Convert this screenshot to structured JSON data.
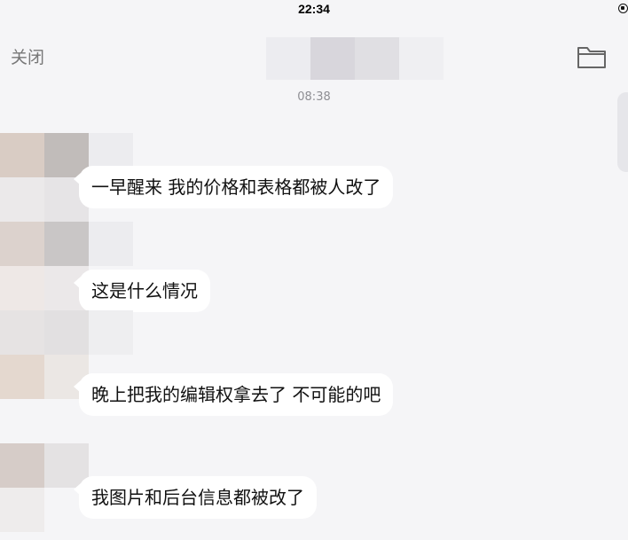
{
  "status_bar": {
    "time": "22:34",
    "orientation_lock_icon": "orientation-lock-icon"
  },
  "nav": {
    "close_label": "关闭",
    "folder_icon": "folder-icon"
  },
  "chat": {
    "timestamp": "08:38",
    "messages": [
      {
        "text": "一早醒来 我的价格和表格都被人改了"
      },
      {
        "text": "这是什么情况"
      },
      {
        "text": "晚上把我的编辑权拿去了  不可能的吧"
      },
      {
        "text": "我图片和后台信息都被改了"
      }
    ]
  },
  "colors": {
    "background": "#f5f5f7",
    "bubble": "#ffffff",
    "secondary_text": "#8e8e93",
    "close_text": "#777777"
  }
}
